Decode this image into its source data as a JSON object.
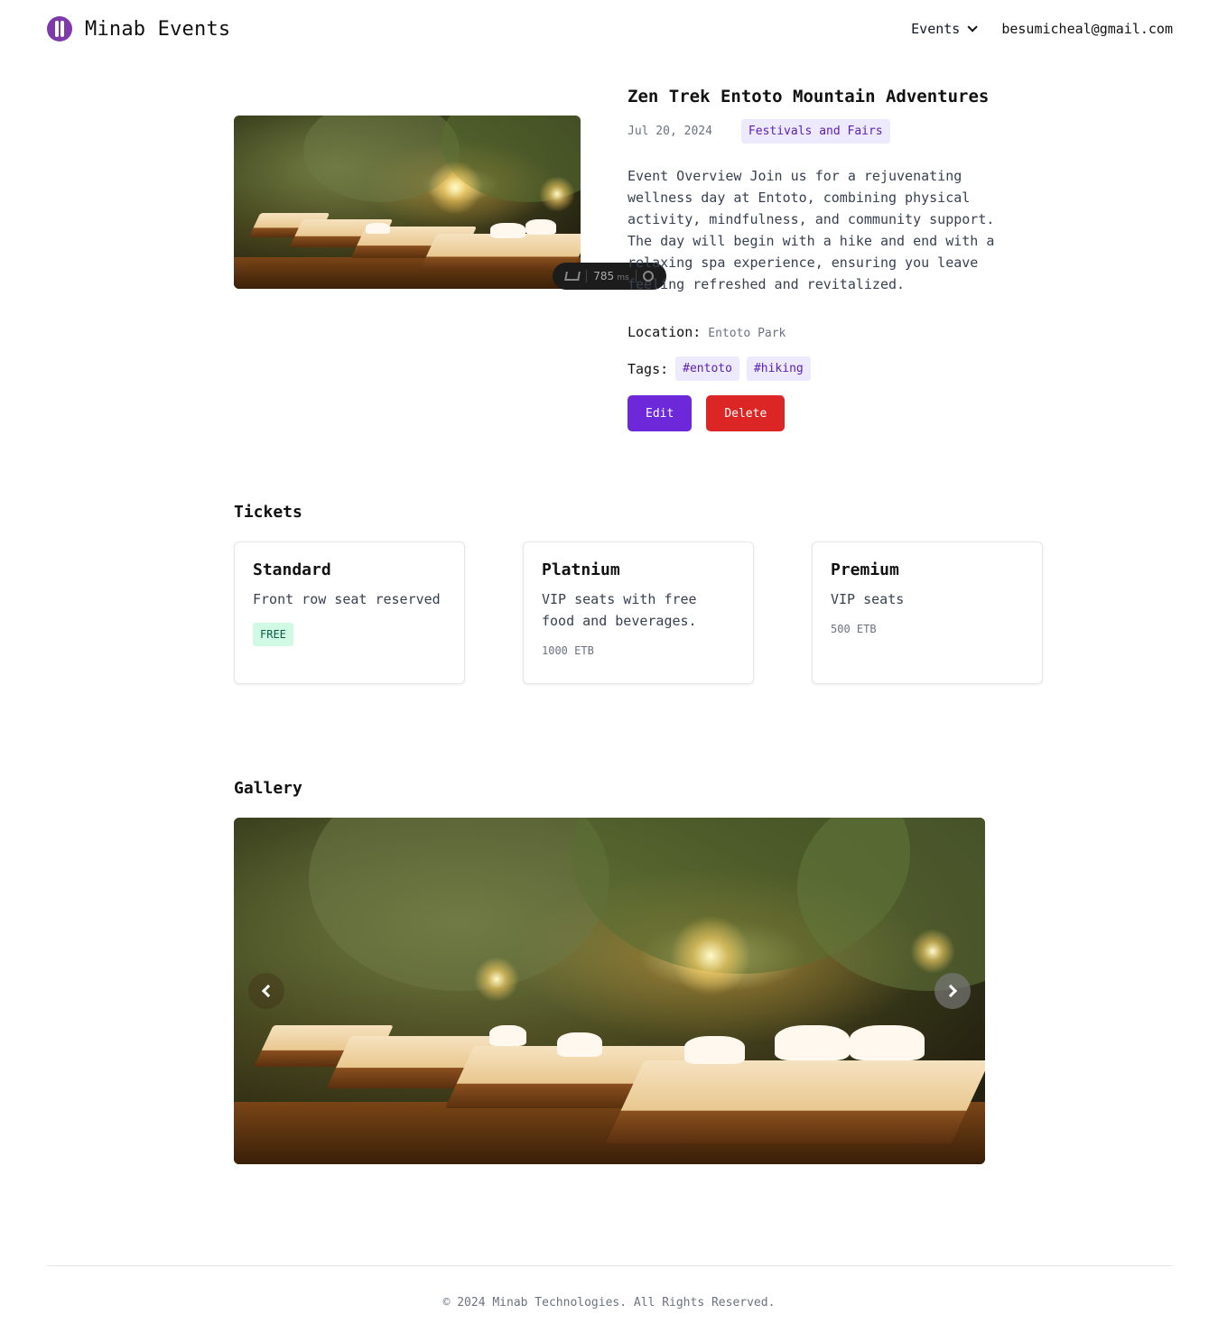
{
  "header": {
    "brand": "Minab Events",
    "nav_events": "Events",
    "user_email": "besumicheal@gmail.com"
  },
  "devtools": {
    "time": "785",
    "unit": "ms"
  },
  "event": {
    "title": "Zen Trek Entoto Mountain Adventures",
    "date": "Jul 20, 2024",
    "category": "Festivals and Fairs",
    "description": "Event Overview Join us for a rejuvenating wellness day at Entoto, combining physical activity, mindfulness, and community support. The day will begin with a hike and end with a relaxing spa experience, ensuring you leave feeling refreshed and revitalized.",
    "location_label": "Location:",
    "location": "Entoto Park",
    "tags_label": "Tags:",
    "tags": [
      "#entoto",
      "#hiking"
    ],
    "edit_label": "Edit",
    "delete_label": "Delete"
  },
  "tickets": {
    "heading": "Tickets",
    "items": [
      {
        "name": "Standard",
        "description": "Front row seat reserved",
        "price": "FREE"
      },
      {
        "name": "Platnium",
        "description": "VIP seats with free food and beverages.",
        "price": "1000 ETB"
      },
      {
        "name": "Premium",
        "description": "VIP seats",
        "price": "500 ETB"
      }
    ]
  },
  "gallery": {
    "heading": "Gallery"
  },
  "footer": {
    "copyright": "© 2024 Minab Technologies. All Rights Reserved."
  },
  "colors": {
    "brand": "#7e3aa8",
    "accent": "#6d28d9",
    "danger": "#dc2626",
    "tag_bg": "#ede9fe",
    "free_bg": "#d1fae5"
  }
}
